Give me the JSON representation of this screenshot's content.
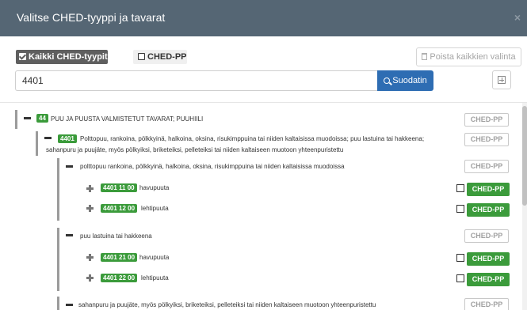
{
  "dialog": {
    "title": "Valitse CHED-tyyppi ja tavarat",
    "close_icon": "×"
  },
  "filters": {
    "all_types_label": "Kaikki CHED-tyypit",
    "ched_pp_label": "CHED-PP",
    "clear_all_label": "Poista kaikkien valinta"
  },
  "search": {
    "value": "4401",
    "button_label": "Suodatin"
  },
  "tree": {
    "tag": "CHED-PP",
    "rows": [
      {
        "code": "44",
        "text": "PUU JA PUUSTA VALMISTETUT TAVARAT; PUUHIILI"
      },
      {
        "code": "4401",
        "text": "Polttopuu, rankoina, pölkkyinä, halkoina, oksina, risukimppuina tai niiden kaltaisissa muodoissa; puu lastuina tai hakkeena;",
        "text2": "sahanpuru ja puujäte, myös pölkyiksi, briketeiksi, pelleteiksi tai niiden kaltaiseen muotoon yhteenpuristettu"
      },
      {
        "code": "",
        "text": "polttopuu rankoina, pölkkyinä, halkoina, oksina, risukimppuina tai niiden kaltaisissa muodoissa"
      },
      {
        "code": "4401 11 00",
        "text": "havupuuta"
      },
      {
        "code": "4401 12 00",
        "text": "lehtipuuta"
      },
      {
        "code": "",
        "text": "puu lastuina tai hakkeena"
      },
      {
        "code": "4401 21 00",
        "text": "havupuuta"
      },
      {
        "code": "4401 22 00",
        "text": "lehtipuuta"
      },
      {
        "code": "",
        "text": "sahanpuru ja puujäte, myös pölkyiksi, briketeiksi, pelleteiksi tai niiden kaltaiseen muotoon yhteenpuristettu"
      }
    ]
  },
  "colors": {
    "header": "#556674",
    "primary": "#2e6db3",
    "badge_green": "#3b9b3b"
  }
}
